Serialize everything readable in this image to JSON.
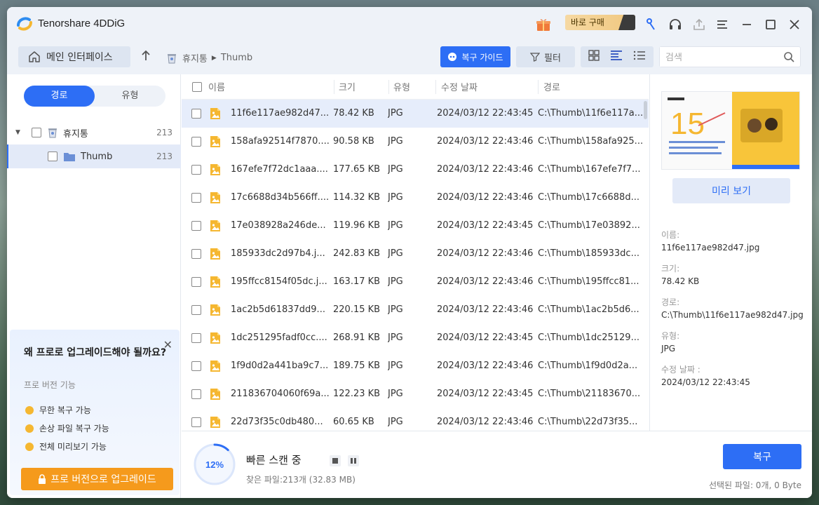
{
  "app": {
    "title": "Tenorshare 4DDiG",
    "buy_label": "바로 구매"
  },
  "toolbar": {
    "home_label": "메인 인터페이스",
    "breadcrumb": [
      "휴지통",
      "Thumb"
    ],
    "guide_label": "복구 가이드",
    "filter_label": "필터",
    "search_placeholder": "검색"
  },
  "sidebar": {
    "tabs": [
      "경로",
      "유형"
    ],
    "tree": [
      {
        "label": "휴지통",
        "count": "213"
      },
      {
        "label": "Thumb",
        "count": "213"
      }
    ],
    "promo": {
      "title": "왜 프로로 업그레이드해야 될까요?",
      "subtitle": "프로 버전 기능",
      "features": [
        "무한 복구 가능",
        "손상 파일 복구 가능",
        "전체 미리보기 가능"
      ],
      "upgrade_label": "프로 버전으로 업그레이드"
    }
  },
  "table": {
    "headers": [
      "이름",
      "크기",
      "유형",
      "수정 날짜",
      "경로"
    ],
    "rows": [
      {
        "name": "11f6e117ae982d47...",
        "size": "78.42 KB",
        "type": "JPG",
        "date": "2024/03/12 22:43:45",
        "path": "C:\\Thumb\\11f6e117a..."
      },
      {
        "name": "158afa92514f7870....",
        "size": "90.58 KB",
        "type": "JPG",
        "date": "2024/03/12 22:43:46",
        "path": "C:\\Thumb\\158afa925..."
      },
      {
        "name": "167efe7f72dc1aaa....",
        "size": "177.65 KB",
        "type": "JPG",
        "date": "2024/03/12 22:43:46",
        "path": "C:\\Thumb\\167efe7f7..."
      },
      {
        "name": "17c6688d34b566ff....",
        "size": "114.32 KB",
        "type": "JPG",
        "date": "2024/03/12 22:43:46",
        "path": "C:\\Thumb\\17c6688d..."
      },
      {
        "name": "17e038928a246de...",
        "size": "119.96 KB",
        "type": "JPG",
        "date": "2024/03/12 22:43:45",
        "path": "C:\\Thumb\\17e03892..."
      },
      {
        "name": "185933dc2d97b4.j...",
        "size": "242.83 KB",
        "type": "JPG",
        "date": "2024/03/12 22:43:46",
        "path": "C:\\Thumb\\185933dc..."
      },
      {
        "name": "195ffcc8154f05dc.j...",
        "size": "163.17 KB",
        "type": "JPG",
        "date": "2024/03/12 22:43:46",
        "path": "C:\\Thumb\\195ffcc81..."
      },
      {
        "name": "1ac2b5d61837dd9...",
        "size": "220.15 KB",
        "type": "JPG",
        "date": "2024/03/12 22:43:46",
        "path": "C:\\Thumb\\1ac2b5d6..."
      },
      {
        "name": "1dc251295fadf0cc....",
        "size": "268.91 KB",
        "type": "JPG",
        "date": "2024/03/12 22:43:45",
        "path": "C:\\Thumb\\1dc25129..."
      },
      {
        "name": "1f9d0d2a441ba9c7...",
        "size": "189.75 KB",
        "type": "JPG",
        "date": "2024/03/12 22:43:46",
        "path": "C:\\Thumb\\1f9d0d2a..."
      },
      {
        "name": "211836704060f69a...",
        "size": "122.23 KB",
        "type": "JPG",
        "date": "2024/03/12 22:43:45",
        "path": "C:\\Thumb\\21183670..."
      },
      {
        "name": "22d73f35c0db480...",
        "size": "60.65 KB",
        "type": "JPG",
        "date": "2024/03/12 22:43:46",
        "path": "C:\\Thumb\\22d73f35..."
      }
    ]
  },
  "preview": {
    "thumb_number": "15",
    "button_label": "미리 보기",
    "labels": [
      "이름:",
      "크기:",
      "경로:",
      "유형:",
      "수정 날짜 :"
    ],
    "values": [
      "11f6e117ae982d47.jpg",
      "78.42 KB",
      "C:\\Thumb\\11f6e117ae982d47.jpg",
      "JPG",
      "2024/03/12 22:43:45"
    ]
  },
  "status": {
    "progress_text": "12%",
    "progress": 0.12,
    "title": "빠른 스캔 중",
    "found": "찾은 파일:213개 (32.83 MB)",
    "recover_label": "복구",
    "selected": "선택된 파일: 0개, 0 Byte"
  },
  "colors": {
    "accent": "#2d6ef5",
    "upgrade": "#f59a1c"
  }
}
